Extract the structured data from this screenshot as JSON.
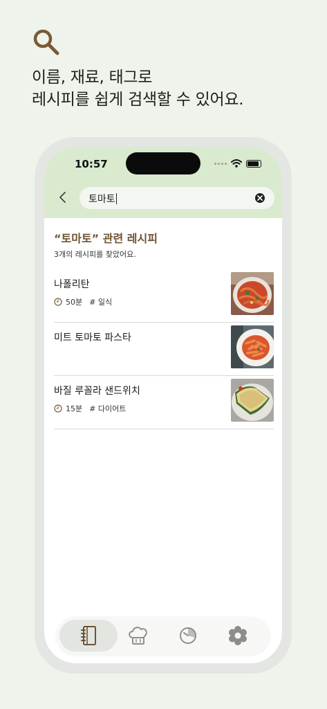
{
  "promo": {
    "icon": "search-icon",
    "headline_line1": "이름, 재료, 태그로",
    "headline_line2": "레시피를 쉽게 검색할 수 있어요."
  },
  "status_bar": {
    "time": "10:57"
  },
  "search": {
    "query": "토마토",
    "back_icon": "chevron-left-icon",
    "clear_icon": "clear-icon"
  },
  "results": {
    "title": "“토마토” 관련 레시피",
    "count_text": "3개의 레시피를 찾았어요.",
    "items": [
      {
        "name": "나폴리탄",
        "time": "50분",
        "tag": "# 일식",
        "thumb": "napolitan-photo"
      },
      {
        "name": "미트 토마토 파스타",
        "time": "",
        "tag": "",
        "thumb": "meat-tomato-pasta-photo"
      },
      {
        "name": "바질 루꼴라 샌드위치",
        "time": "15분",
        "tag": "# 다이어트",
        "thumb": "basil-arugula-sandwich-photo"
      }
    ]
  },
  "tabbar": {
    "tabs": [
      {
        "icon": "recipe-book-icon",
        "active": true
      },
      {
        "icon": "chef-hat-icon",
        "active": false
      },
      {
        "icon": "timer-icon",
        "active": false
      },
      {
        "icon": "settings-icon",
        "active": false
      }
    ]
  },
  "colors": {
    "background": "#eef4ec",
    "header_green": "#d9eacf",
    "accent_brown": "#6d5232"
  }
}
